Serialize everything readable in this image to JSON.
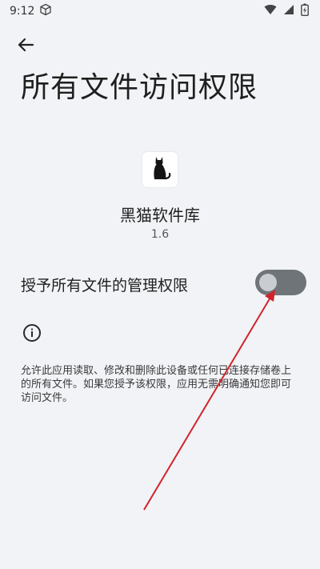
{
  "status_bar": {
    "time": "9:12"
  },
  "header": {
    "title": "所有文件访问权限"
  },
  "app": {
    "name": "黑猫软件库",
    "version": "1.6"
  },
  "permission": {
    "label": "授予所有文件的管理权限",
    "enabled": false
  },
  "info": {
    "description": "允许此应用读取、修改和删除此设备或任何已连接存储卷上的所有文件。如果您授予该权限，应用无需明确通知您即可访问文件。"
  },
  "icons": {
    "status_left": "box-icon",
    "status_right": [
      "wifi-icon",
      "signal-icon",
      "battery-icon"
    ],
    "back": "back-arrow-icon",
    "app": "black-cat-icon",
    "info": "info-icon"
  },
  "colors": {
    "background": "#f1f3f6",
    "toggle_track": "#6f7479",
    "toggle_knob": "#c9cdd1",
    "annotation_arrow": "#d3232a"
  }
}
